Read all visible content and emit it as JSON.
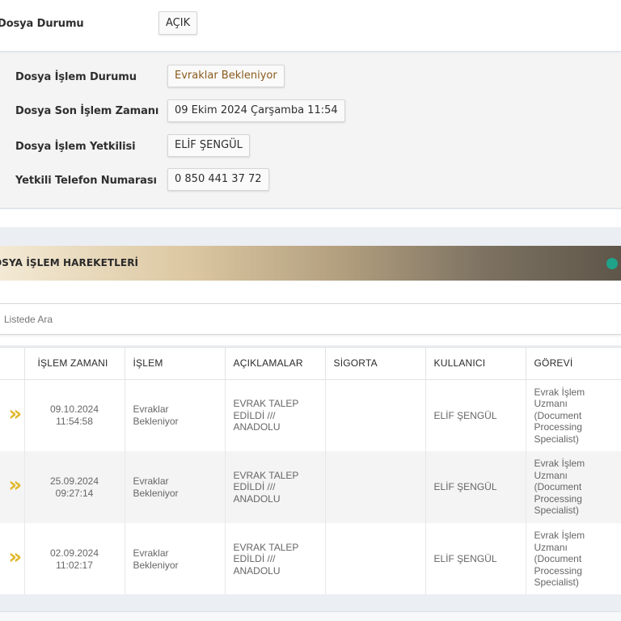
{
  "top": {
    "label": "Dosya Durumu",
    "value": "AÇIK"
  },
  "info": {
    "rows": [
      {
        "label": "Dosya İşlem Durumu",
        "value": "Evraklar Bekleniyor",
        "color": "#8a5a1c"
      },
      {
        "label": "Dosya Son İşlem Zamanı",
        "value": "09 Ekim 2024 Çarşamba 11:54",
        "color": "#2e2e2e"
      },
      {
        "label": "Dosya İşlem Yetkilisi",
        "value": "ELİF ŞENGÜL",
        "color": "#2e2e2e"
      },
      {
        "label": "Yetkili Telefon Numarası",
        "value": "0 850 441 37 72",
        "color": "#2e2e2e"
      }
    ]
  },
  "section": {
    "title": "OSYA İŞLEM HAREKETLERİ",
    "dot_color": "#1fa38a"
  },
  "search": {
    "placeholder": "Listede Ara"
  },
  "table": {
    "headers": [
      "İŞLEM ZAMANI",
      "İŞLEM",
      "AÇIKLAMALAR",
      "SİGORTA",
      "KULLANICI",
      "GÖREVİ"
    ],
    "rows": [
      {
        "date": "09.10.2024",
        "time": "11:54:58",
        "islem_1": "Evraklar",
        "islem_2": "Bekleniyor",
        "aciklama_1": "EVRAK TALEP",
        "aciklama_2": "EDİLDİ ///",
        "aciklama_3": "ANADOLU",
        "sigorta": "",
        "kullanici": "ELİF ŞENGÜL",
        "gorev_1": "Evrak İşlem",
        "gorev_2": "Uzmanı",
        "gorev_3": "(Document",
        "gorev_4": "Processing",
        "gorev_5": "Specialist)"
      },
      {
        "date": "25.09.2024",
        "time": "09:27:14",
        "islem_1": "Evraklar",
        "islem_2": "Bekleniyor",
        "aciklama_1": "EVRAK TALEP",
        "aciklama_2": "EDİLDİ ///",
        "aciklama_3": "ANADOLU",
        "sigorta": "",
        "kullanici": "ELİF ŞENGÜL",
        "gorev_1": "Evrak İşlem",
        "gorev_2": "Uzmanı",
        "gorev_3": "(Document",
        "gorev_4": "Processing",
        "gorev_5": "Specialist)"
      },
      {
        "date": "02.09.2024",
        "time": "11:02:17",
        "islem_1": "Evraklar",
        "islem_2": "Bekleniyor",
        "aciklama_1": "EVRAK TALEP",
        "aciklama_2": "EDİLDİ ///",
        "aciklama_3": "ANADOLU",
        "sigorta": "",
        "kullanici": "ELİF ŞENGÜL",
        "gorev_1": "Evrak İşlem",
        "gorev_2": "Uzmanı",
        "gorev_3": "(Document",
        "gorev_4": "Processing",
        "gorev_5": "Specialist)"
      }
    ]
  },
  "colors": {
    "accent_chevron": "#e0b72b",
    "status_dot": "#1fa38a"
  }
}
